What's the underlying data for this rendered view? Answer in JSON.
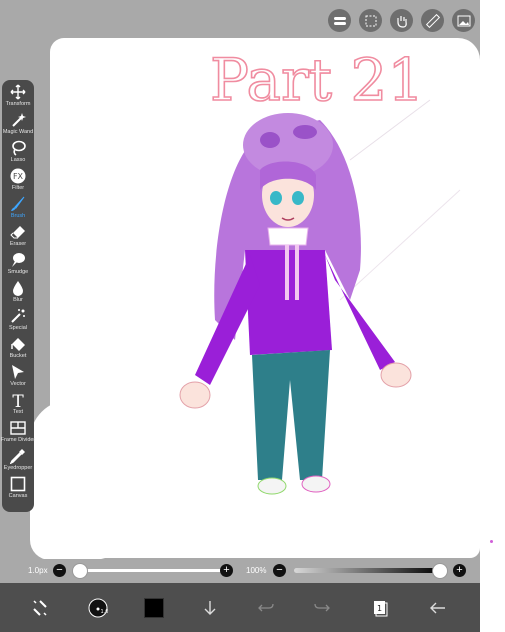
{
  "app": {
    "accent": "#3ea6ff",
    "toolbar_bg": "#4a4a4a",
    "frame_bg": "#a9a9a9"
  },
  "top_toolbar": {
    "buttons": [
      {
        "icon": "toggle-icon"
      },
      {
        "icon": "selection-icon"
      },
      {
        "icon": "hand-icon"
      },
      {
        "icon": "ruler-icon"
      },
      {
        "icon": "image-icon"
      }
    ]
  },
  "tools": [
    {
      "label": "Transform",
      "icon": "transform-icon"
    },
    {
      "label": "Magic Wand",
      "icon": "magic-wand-icon"
    },
    {
      "label": "Lasso",
      "icon": "lasso-icon"
    },
    {
      "label": "Filter",
      "icon": "fx-icon"
    },
    {
      "label": "Brush",
      "icon": "brush-icon",
      "selected": true
    },
    {
      "label": "Eraser",
      "icon": "eraser-icon"
    },
    {
      "label": "Smudge",
      "icon": "smudge-icon"
    },
    {
      "label": "Blur",
      "icon": "blur-icon"
    },
    {
      "label": "Special",
      "icon": "special-icon"
    },
    {
      "label": "Bucket",
      "icon": "bucket-icon"
    },
    {
      "label": "Vector",
      "icon": "vector-icon"
    },
    {
      "label": "Text",
      "icon": "text-icon"
    },
    {
      "label": "Frame Divider",
      "icon": "frame-divider-icon"
    },
    {
      "label": "Eyedropper",
      "icon": "eyedropper-icon"
    },
    {
      "label": "Canvas",
      "icon": "canvas-icon"
    }
  ],
  "canvas": {
    "text": "Part 21"
  },
  "brush_size": {
    "label": "1.0px",
    "value": 0.0
  },
  "opacity": {
    "label": "100%",
    "value": 1.0
  },
  "bottom_bar": {
    "current_color": "#000000",
    "layer_count": "1",
    "icons": [
      "quick-menu-icon",
      "brush-settings-icon",
      "color-swatch",
      "download-icon",
      "undo-icon",
      "redo-icon",
      "layers-icon",
      "back-arrow-icon"
    ]
  }
}
